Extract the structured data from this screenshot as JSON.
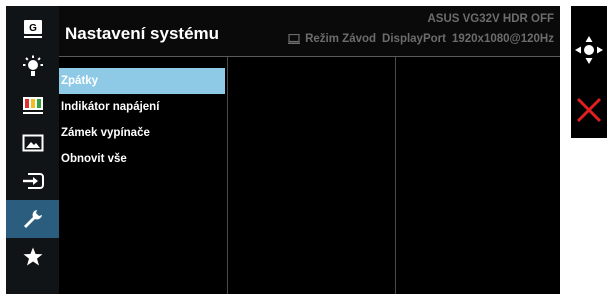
{
  "header": {
    "title": "Nastavení systému",
    "model": "ASUS VG32V HDR OFF",
    "mode": "Režim Závod",
    "input": "DisplayPort",
    "resolution": "1920x1080@120Hz"
  },
  "sidebar": {
    "items": [
      {
        "icon": "gamevisual-icon",
        "label": "G"
      },
      {
        "icon": "brightness-icon"
      },
      {
        "icon": "color-bars-icon"
      },
      {
        "icon": "image-icon"
      },
      {
        "icon": "input-select-icon"
      },
      {
        "icon": "wrench-icon",
        "selected": true
      },
      {
        "icon": "star-icon"
      }
    ]
  },
  "menu": {
    "items": [
      {
        "label": "Zpátky",
        "selected": true
      },
      {
        "label": "Indikátor napájení"
      },
      {
        "label": "Zámek vypínače"
      },
      {
        "label": "Obnovit vše"
      }
    ]
  },
  "nav": {
    "move_icon": "joystick-move-icon",
    "exit_icon": "close-icon"
  },
  "colors": {
    "selected_sidebar": "#2a5d7e",
    "selected_menu": "#8ecae6",
    "exit": "#e02020"
  }
}
